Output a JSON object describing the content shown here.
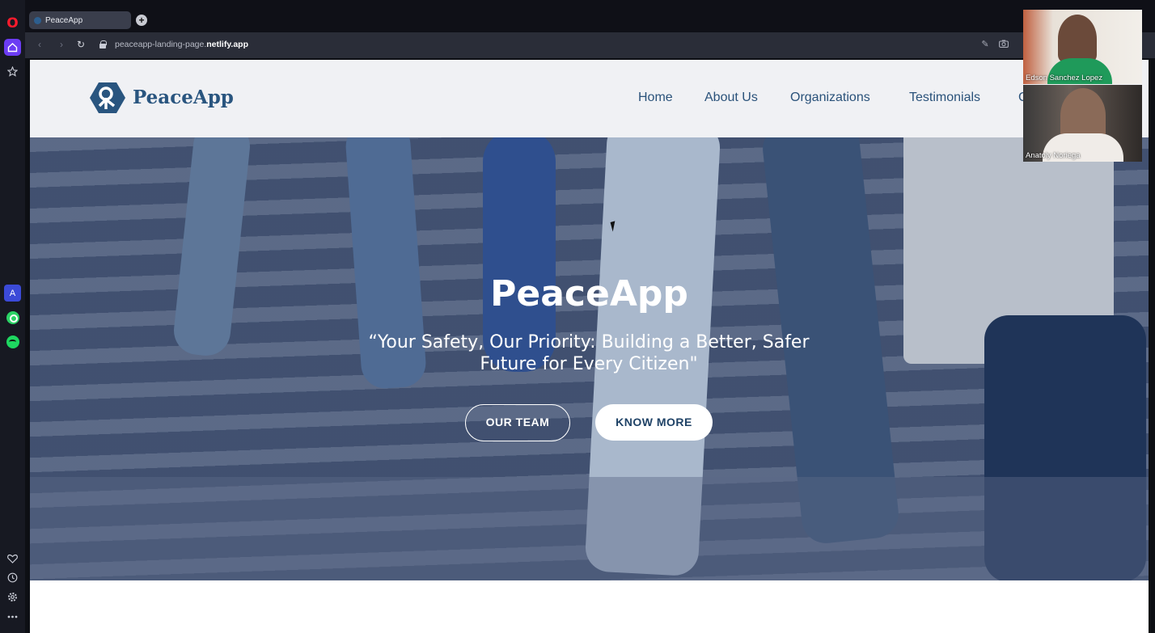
{
  "browser": {
    "tab_title": "PeaceApp",
    "url_prefix": "peaceapp-landing-page.",
    "url_domain": "netlify.app",
    "new_tab_symbol": "+"
  },
  "site": {
    "brand": "PeaceApp",
    "nav": [
      "Home",
      "About Us",
      "Organizations",
      "Testimonials",
      "C"
    ],
    "hero_title": "PeaceApp",
    "hero_tagline": "“Your Safety, Our Priority: Building a Better, Safer Future for Every Citizen\"",
    "btn_team": "OUR TEAM",
    "btn_know": "KNOW MORE"
  },
  "call": {
    "participant_1": "Edson Sanchez Lopez",
    "participant_2": "Anatoly Noriega"
  },
  "colors": {
    "brand": "#29557f",
    "sidebar_accent": "#6c3cf4",
    "hero_overlay": "#283a5f"
  },
  "icons": {
    "sidebar": [
      "opera-logo-icon",
      "home-icon",
      "star-icon",
      "aria-icon",
      "whatsapp-icon",
      "spotify-icon",
      "heart-icon",
      "history-icon",
      "settings-icon",
      "more-icon"
    ],
    "addressbar": [
      "back-icon",
      "forward-icon",
      "reload-icon",
      "lock-icon",
      "edit-icon",
      "camera-icon"
    ]
  }
}
